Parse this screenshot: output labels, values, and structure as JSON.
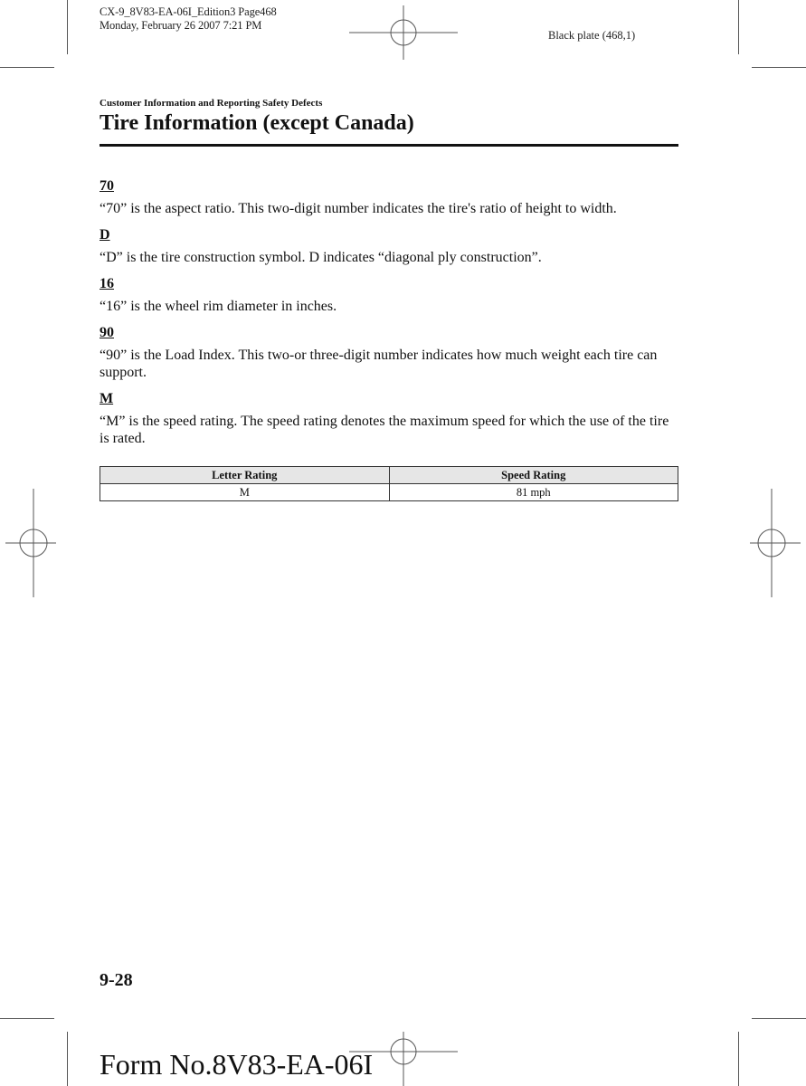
{
  "print_marks": {
    "slug_line_1": "CX-9_8V83-EA-06I_Edition3 Page468",
    "slug_line_2": "Monday, February 26 2007 7:21 PM",
    "plate": "Black plate (468,1)"
  },
  "header": {
    "section": "Customer Information and Reporting Safety Defects",
    "title": "Tire Information (except Canada)"
  },
  "entries": [
    {
      "term": "70",
      "description": "“70” is the aspect ratio. This two-digit number indicates the tire's ratio of height to width."
    },
    {
      "term": "D",
      "description": "“D” is the tire construction symbol. D indicates “diagonal ply construction”."
    },
    {
      "term": "16",
      "description": "“16” is the wheel rim diameter in inches."
    },
    {
      "term": "90",
      "description": "“90” is the Load Index. This two-or three-digit number indicates how much weight each tire can support."
    },
    {
      "term": "M",
      "description": "“M” is the speed rating. The speed rating denotes the maximum speed for which the use of the tire is rated."
    }
  ],
  "rating_table": {
    "headers": [
      "Letter Rating",
      "Speed Rating"
    ],
    "rows": [
      [
        "M",
        "81 mph"
      ]
    ]
  },
  "footer": {
    "page_number": "9-28",
    "form_number": "Form No.8V83-EA-06I"
  }
}
